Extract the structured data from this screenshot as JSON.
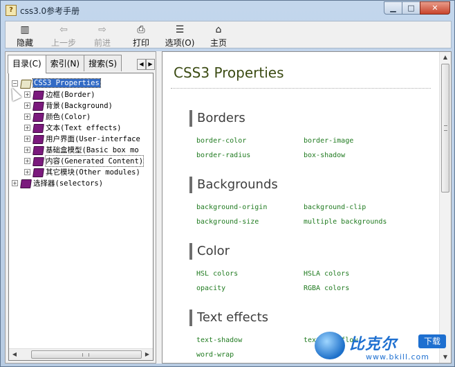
{
  "window": {
    "title": "css3.0参考手册",
    "icon": "chm-help-icon",
    "buttons": {
      "minimize": "▁",
      "maximize": "□",
      "close": "✕"
    }
  },
  "toolbar": {
    "buttons": [
      {
        "label": "隐藏",
        "icon": "hide-pane-icon",
        "glyph": "▥",
        "enabled": true
      },
      {
        "label": "上一步",
        "icon": "back-arrow-icon",
        "glyph": "⇦",
        "enabled": false
      },
      {
        "label": "前进",
        "icon": "forward-arrow-icon",
        "glyph": "⇨",
        "enabled": false
      },
      {
        "label": "打印",
        "icon": "printer-icon",
        "glyph": "⎙",
        "enabled": true
      },
      {
        "label": "选项(O)",
        "icon": "options-icon",
        "glyph": "☰",
        "enabled": true
      },
      {
        "label": "主页",
        "icon": "home-icon",
        "glyph": "⌂",
        "enabled": true
      }
    ]
  },
  "nav": {
    "tabs": [
      {
        "label": "目录(C)",
        "active": true
      },
      {
        "label": "索引(N)",
        "active": false
      },
      {
        "label": "搜索(S)",
        "active": false
      }
    ],
    "tab_scroll": {
      "left": "◀",
      "right": "▶"
    },
    "tree": [
      {
        "label": "CSS3 Properties",
        "level": 0,
        "expander": "−",
        "open": true,
        "selected": true
      },
      {
        "label": "边框(Border)",
        "level": 1,
        "expander": "+"
      },
      {
        "label": "背景(Background)",
        "level": 1,
        "expander": "+"
      },
      {
        "label": "颜色(Color)",
        "level": 1,
        "expander": "+"
      },
      {
        "label": "文本(Text effects)",
        "level": 1,
        "expander": "+"
      },
      {
        "label": "用户界面(User-interface",
        "level": 1,
        "expander": "+"
      },
      {
        "label": "基础盒模型(Basic box mo",
        "level": 1,
        "expander": "+"
      },
      {
        "label": "内容(Generated Content)",
        "level": 1,
        "expander": "+",
        "focused": true
      },
      {
        "label": "其它模块(Other modules)",
        "level": 1,
        "expander": "+"
      },
      {
        "label": "选择器(selectors)",
        "level": 0,
        "expander": "+"
      }
    ],
    "hscroll": {
      "left": "◀",
      "right": "▶"
    }
  },
  "content": {
    "title": "CSS3 Properties",
    "sections": [
      {
        "heading": "Borders",
        "links": [
          "border-color",
          "border-image",
          "border-radius",
          "box-shadow"
        ]
      },
      {
        "heading": "Backgrounds",
        "links": [
          "background-origin",
          "background-clip",
          "background-size",
          "multiple backgrounds"
        ]
      },
      {
        "heading": "Color",
        "links": [
          "HSL colors",
          "HSLA colors",
          "opacity",
          "RGBA colors"
        ]
      },
      {
        "heading": "Text effects",
        "links": [
          "text-shadow",
          "text-overflow",
          "word-wrap"
        ]
      }
    ],
    "vscroll": {
      "up": "▲",
      "down": "▼"
    }
  },
  "watermark": {
    "brand": "比克尔",
    "badge": "下载",
    "url": "www.bkill.com"
  },
  "colors": {
    "title_green": "#3b4b13",
    "link_green": "#1f7a1f",
    "selection_blue": "#316ac5",
    "book_purple": "#7b1a7d"
  }
}
